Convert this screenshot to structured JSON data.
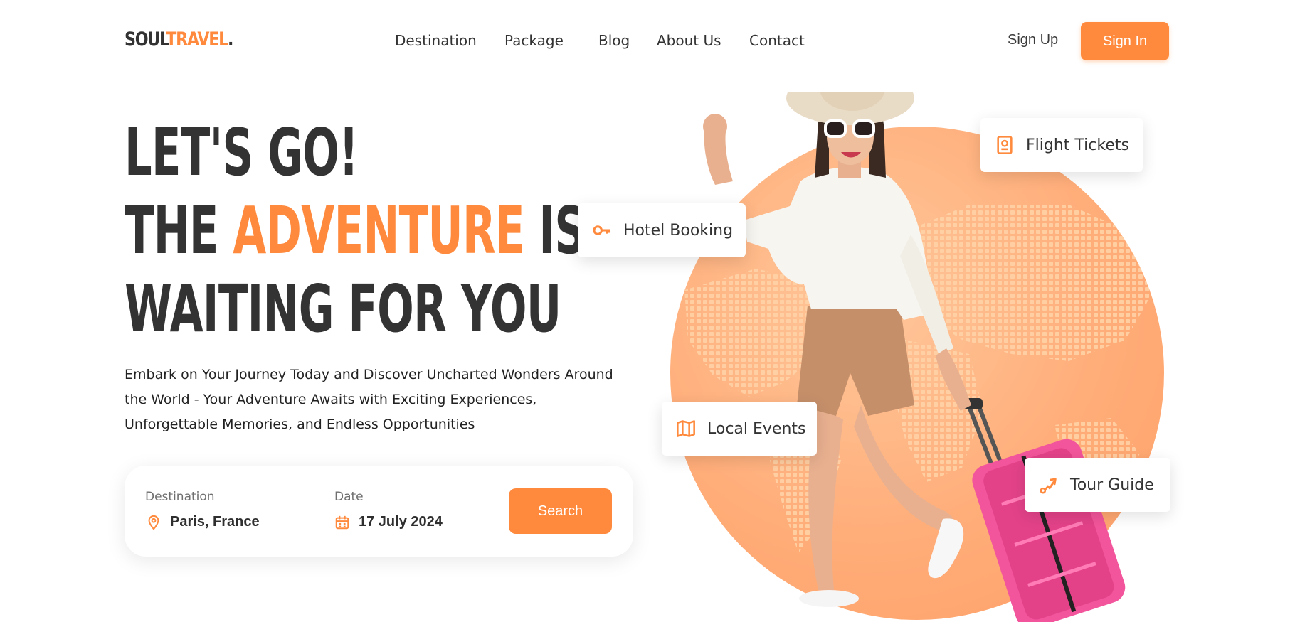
{
  "brand": {
    "part1": "SOUL",
    "part2": "TRAVEL",
    "part3": "."
  },
  "nav": {
    "items": [
      {
        "label": "Destination"
      },
      {
        "label": "Package"
      },
      {
        "label": "Blog"
      },
      {
        "label": "About Us"
      },
      {
        "label": "Contact"
      }
    ]
  },
  "auth": {
    "signup_label": "Sign Up",
    "signin_label": "Sign In"
  },
  "hero": {
    "line1": "LET'S GO!",
    "line2_pre": "THE ",
    "line2_accent": "ADVENTURE",
    "line2_post": " IS",
    "line3": "WAITING FOR YOU",
    "description": "Embark on Your Journey Today and Discover Uncharted Wonders Around the World - Your Adventure Awaits with Exciting Experiences, Unforgettable Memories, and Endless Opportunities"
  },
  "search": {
    "destination_label": "Destination",
    "destination_value": "Paris, France",
    "date_label": "Date",
    "date_value": "17 July 2024",
    "button_label": "Search"
  },
  "features": {
    "flight": {
      "label": "Flight Tickets",
      "icon": "passport-icon"
    },
    "hotel": {
      "label": "Hotel Booking",
      "icon": "key-icon"
    },
    "events": {
      "label": "Local Events",
      "icon": "map-icon"
    },
    "guide": {
      "label": "Tour Guide",
      "icon": "route-icon"
    }
  },
  "colors": {
    "accent": "#ff8a3d",
    "text": "#333333",
    "suitcase": "#f2559b"
  }
}
